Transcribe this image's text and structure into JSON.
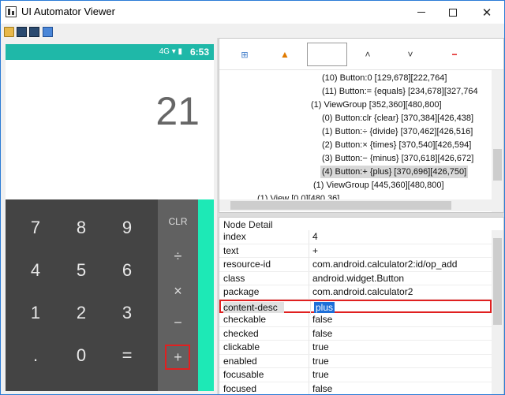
{
  "window": {
    "title": "UI Automator Viewer",
    "controls": {
      "minimize": "",
      "maximize": "",
      "close": "✕"
    }
  },
  "toolbar": {
    "icons": [
      "open-folder-icon",
      "device-screenshot-icon",
      "device-screenshot-compressed-icon",
      "save-icon"
    ]
  },
  "device": {
    "status": {
      "icons": "4G ▾ ▮",
      "time": "6:53"
    },
    "display_value": "21",
    "digits": [
      {
        "label": "7"
      },
      {
        "label": "8"
      },
      {
        "label": "9"
      },
      {
        "label": "4"
      },
      {
        "label": "5"
      },
      {
        "label": "6"
      },
      {
        "label": "1"
      },
      {
        "label": "2"
      },
      {
        "label": "3"
      },
      {
        "label": "."
      },
      {
        "label": "0"
      },
      {
        "label": "="
      }
    ],
    "ops": [
      {
        "label": "CLR"
      },
      {
        "label": "÷"
      },
      {
        "label": "×"
      },
      {
        "label": "−"
      },
      {
        "label": "+"
      }
    ],
    "accent_color": "#1de9b6",
    "status_color": "#1fb8a8"
  },
  "tree_toolbar": {
    "expand_icon": "⊞",
    "warning_icon": "▲",
    "up_icon": "˄",
    "down_icon": "˅",
    "remove_icon": "−"
  },
  "tree": {
    "lines": [
      "(10) Button:0 [129,678][222,764]",
      "(11) Button:= {equals} [234,678][327,764",
      "(1) ViewGroup [352,360][480,800]",
      "(0) Button:clr {clear} [370,384][426,438]",
      "(1) Button:÷ {divide} [370,462][426,516]",
      "(2) Button:× {times} [370,540][426,594]",
      "(3) Button:− {minus} [370,618][426,672]",
      "(4) Button:+ {plus} [370,696][426,750]",
      "(1) ViewGroup [445,360][480,800]",
      "(1) View [0,0][480,36]"
    ],
    "selected_index": 7
  },
  "detail": {
    "header": "Node Detail",
    "rows": [
      {
        "key": "index",
        "value": "4"
      },
      {
        "key": "text",
        "value": "+"
      },
      {
        "key": "resource-id",
        "value": "com.android.calculator2:id/op_add"
      },
      {
        "key": "class",
        "value": "android.widget.Button"
      },
      {
        "key": "package",
        "value": "com.android.calculator2"
      },
      {
        "key": "content-desc",
        "value": "plus"
      },
      {
        "key": "checkable",
        "value": "false"
      },
      {
        "key": "checked",
        "value": "false"
      },
      {
        "key": "clickable",
        "value": "true"
      },
      {
        "key": "enabled",
        "value": "true"
      },
      {
        "key": "focusable",
        "value": "true"
      },
      {
        "key": "focused",
        "value": "false"
      }
    ],
    "highlight_key": "content-desc"
  }
}
